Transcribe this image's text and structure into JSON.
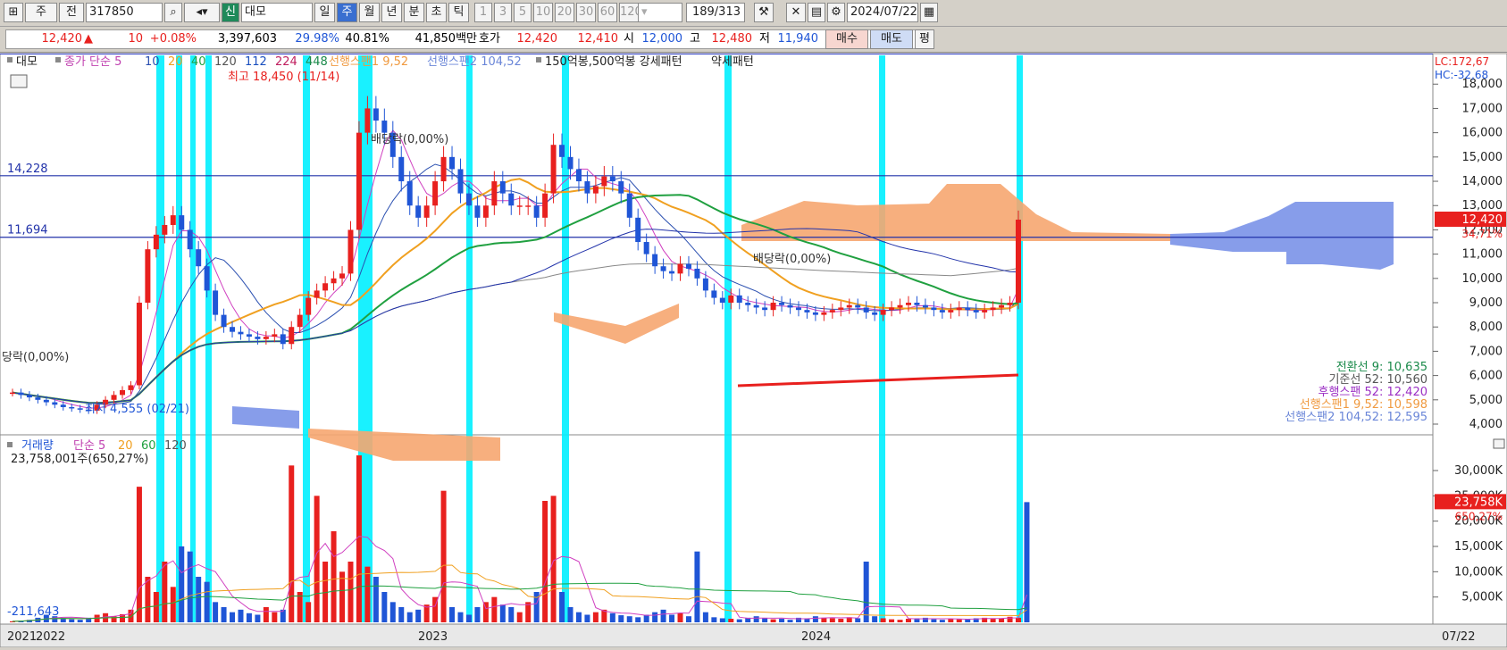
{
  "toolbar": {
    "icon1": "⊞",
    "period_type": "주",
    "prev_label": "전",
    "code": "317850",
    "badge_new": "신",
    "name": "대모",
    "periods": [
      "일",
      "주",
      "월",
      "년",
      "분",
      "초",
      "틱"
    ],
    "minutes": [
      "1",
      "3",
      "5",
      "10",
      "20",
      "30",
      "60",
      "120"
    ],
    "count": "189",
    "total": "/313",
    "date": "2024/07/22"
  },
  "quote": {
    "price": "12,420",
    "arrow": "▲",
    "change": "10",
    "change_pct": "+0.08%",
    "volume": "3,397,603",
    "pct1": "29.98%",
    "pct2": "40.81%",
    "amount": "41,850백만",
    "hoga_label": "호가",
    "ask": "12,420",
    "bid": "12,410",
    "open_label": "시",
    "open": "12,000",
    "high_label": "고",
    "high": "12,480",
    "low_label": "저",
    "low": "11,940",
    "buy": "매수",
    "sell": "매도",
    "flat": "평"
  },
  "legend": {
    "name": "대모",
    "ma": "종가 단순 5",
    "ma_periods": [
      "10",
      "20",
      "40",
      "120",
      "112",
      "224",
      "448"
    ],
    "span1": "선행스팬1 9,52",
    "span2": "선행스팬2 104,52",
    "pattern": "150억봉,500억봉 강세패턴",
    "weak": "약세패턴"
  },
  "annotations": {
    "max": "최고 18,450 (11/14)",
    "min": "최저 4,555 (02/21)",
    "div1": "배당락(0,00%)",
    "div2": "배당락(0,00%)",
    "div3": "당락(0,00%)",
    "lc": "LC:172,67",
    "hc": "HC:-32,68",
    "line1": "14,228",
    "line2": "11,694",
    "price_tag": "12,420",
    "price_pct": "34,71%"
  },
  "ichimoku": [
    {
      "label": "전환선 9: 10,635",
      "color": "#1a8a4a"
    },
    {
      "label": "기준선 52: 10,560",
      "color": "#555555"
    },
    {
      "label": "후행스팬 52: 12,420",
      "color": "#9b2fc4"
    },
    {
      "label": "선행스팬1 9,52: 10,598",
      "color": "#f09a40"
    },
    {
      "label": "선행스팬2 104,52: 12,595",
      "color": "#6a86d8"
    }
  ],
  "volume_panel": {
    "title": "거래량",
    "ma": "단순 5",
    "ma_periods": [
      "20",
      "60",
      "120"
    ],
    "value": "23,758,001주(650,27%)",
    "min_label": "-211,643",
    "tag": "23,758K",
    "tag_pct": "650,27%"
  },
  "x_axis": {
    "labels": [
      "2021",
      "2022",
      "2023",
      "2024"
    ],
    "end": "07/22"
  },
  "chart_data": {
    "type": "candlestick",
    "price_axis": {
      "ticks": [
        "18,000",
        "17,000",
        "16,000",
        "15,000",
        "14,000",
        "13,000",
        "12,000",
        "11,000",
        "10,000",
        "9,000",
        "8,000",
        "7,000",
        "6,000",
        "5,000",
        "4,000"
      ],
      "range": [
        4000,
        18450
      ]
    },
    "volume_axis": {
      "ticks": [
        "30,000K",
        "25,000K",
        "20,000K",
        "15,000K",
        "10,000K",
        "5,000K"
      ],
      "range": [
        0,
        33000
      ]
    },
    "close_series": [
      5300,
      5200,
      5100,
      5000,
      4900,
      4800,
      4700,
      4650,
      4600,
      4555,
      4800,
      5000,
      5200,
      5400,
      5600,
      9000,
      11200,
      11800,
      12200,
      12600,
      12000,
      11200,
      10500,
      9500,
      8500,
      8000,
      7800,
      7700,
      7600,
      7500,
      7600,
      7700,
      7300,
      8000,
      8500,
      9200,
      9500,
      9800,
      10000,
      10200,
      12000,
      16000,
      17000,
      16500,
      16000,
      15000,
      14000,
      13000,
      12500,
      13000,
      14000,
      15000,
      14500,
      13500,
      13000,
      12500,
      13000,
      14000,
      13500,
      13000,
      13000,
      13000,
      12500,
      13500,
      15500,
      15000,
      14500,
      14000,
      13500,
      13800,
      14200,
      14000,
      13500,
      12500,
      11500,
      11000,
      10500,
      10300,
      10200,
      10600,
      10400,
      10000,
      9500,
      9200,
      9000,
      9300,
      9000,
      8900,
      8800,
      8700,
      9000,
      8900,
      8800,
      8700,
      8600,
      8500,
      8600,
      8700,
      8800,
      8900,
      8800,
      8600,
      8500,
      8700,
      8800,
      8900,
      9000,
      8900,
      8800,
      8700,
      8600,
      8700,
      8800,
      8700,
      8600,
      8700,
      8800,
      8900,
      9000,
      12420
    ],
    "volume_series_k": [
      200,
      300,
      500,
      900,
      1500,
      1200,
      800,
      600,
      500,
      900,
      1500,
      1800,
      1200,
      1600,
      2500,
      26800,
      9000,
      6000,
      12000,
      7000,
      15000,
      14000,
      9000,
      8000,
      4000,
      3000,
      2000,
      2500,
      1800,
      1500,
      3000,
      2000,
      2500,
      31000,
      6000,
      4000,
      25000,
      12000,
      18000,
      10000,
      12000,
      33000,
      11000,
      9000,
      6000,
      4000,
      3000,
      2000,
      2500,
      3500,
      5000,
      26000,
      3000,
      2000,
      1500,
      3000,
      4000,
      5000,
      3500,
      3000,
      2000,
      4000,
      6000,
      24000,
      25000,
      6000,
      3000,
      2000,
      1500,
      2000,
      2500,
      1800,
      1400,
      1200,
      1000,
      1500,
      2000,
      2500,
      1500,
      1800,
      1200,
      14000,
      2000,
      1000,
      800,
      700,
      600,
      900,
      1200,
      800,
      600,
      700,
      500,
      900,
      800,
      1200,
      900,
      800,
      700,
      1000,
      800,
      12000,
      1200,
      800,
      600,
      500,
      700,
      800,
      900,
      600,
      500,
      700,
      600,
      700,
      800,
      900,
      700,
      800,
      1100,
      900,
      23758
    ]
  },
  "colors": {
    "up": "#e8201e",
    "down": "#1f55d6",
    "highlight": "#00f0ff",
    "ma5": "#d040c0",
    "ma10": "#2a4fb0",
    "ma20": "#f0a020",
    "ma40": "#20a040",
    "span_up": "#f6a670",
    "span_down": "#7a92e8"
  }
}
